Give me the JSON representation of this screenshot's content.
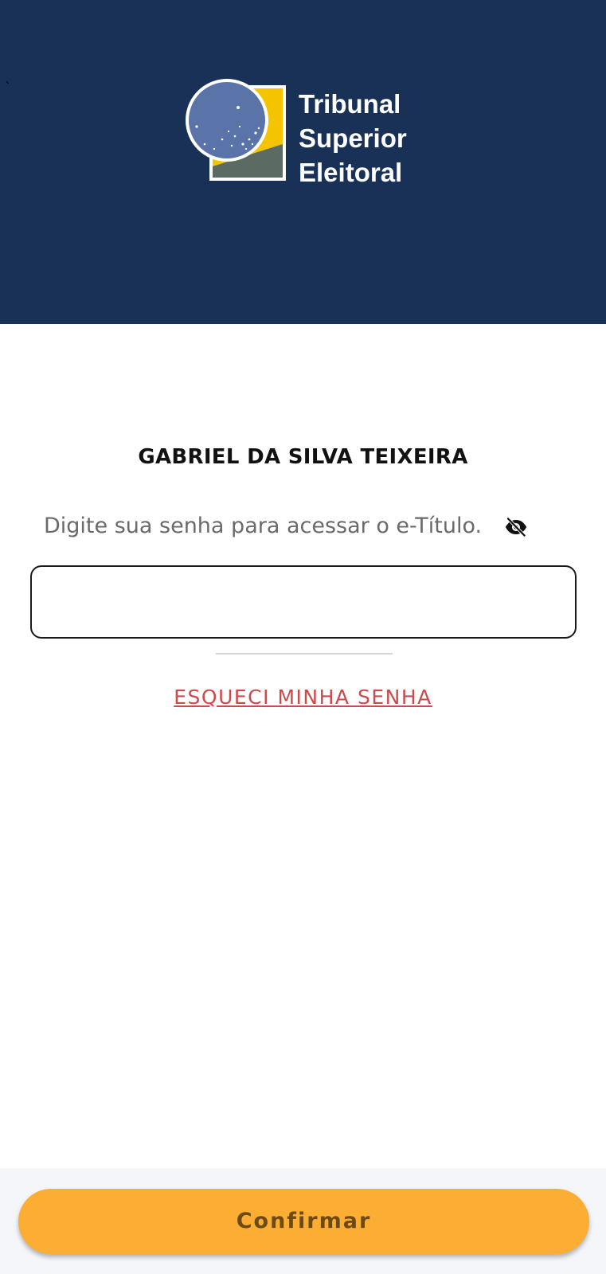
{
  "header": {
    "logo_lines": [
      "Tribunal",
      "Superior",
      "Eleitoral"
    ],
    "stray_mark": "`"
  },
  "login": {
    "user_name": "GABRIEL DA SILVA TEIXEIRA",
    "instruction": "Digite sua senha para acessar o e-Título.",
    "visibility_icon": "eye-off-icon",
    "password_value": "",
    "forgot_link": "ESQUECI MINHA SENHA"
  },
  "footer": {
    "confirm_label": "Confirmar"
  },
  "colors": {
    "header_bg": "#1a3157",
    "accent_button": "#fcae34",
    "link": "#cc4a4a",
    "logo_gold": "#f5c400",
    "logo_globe": "#5a73a8",
    "logo_gray": "#5b6b63"
  }
}
